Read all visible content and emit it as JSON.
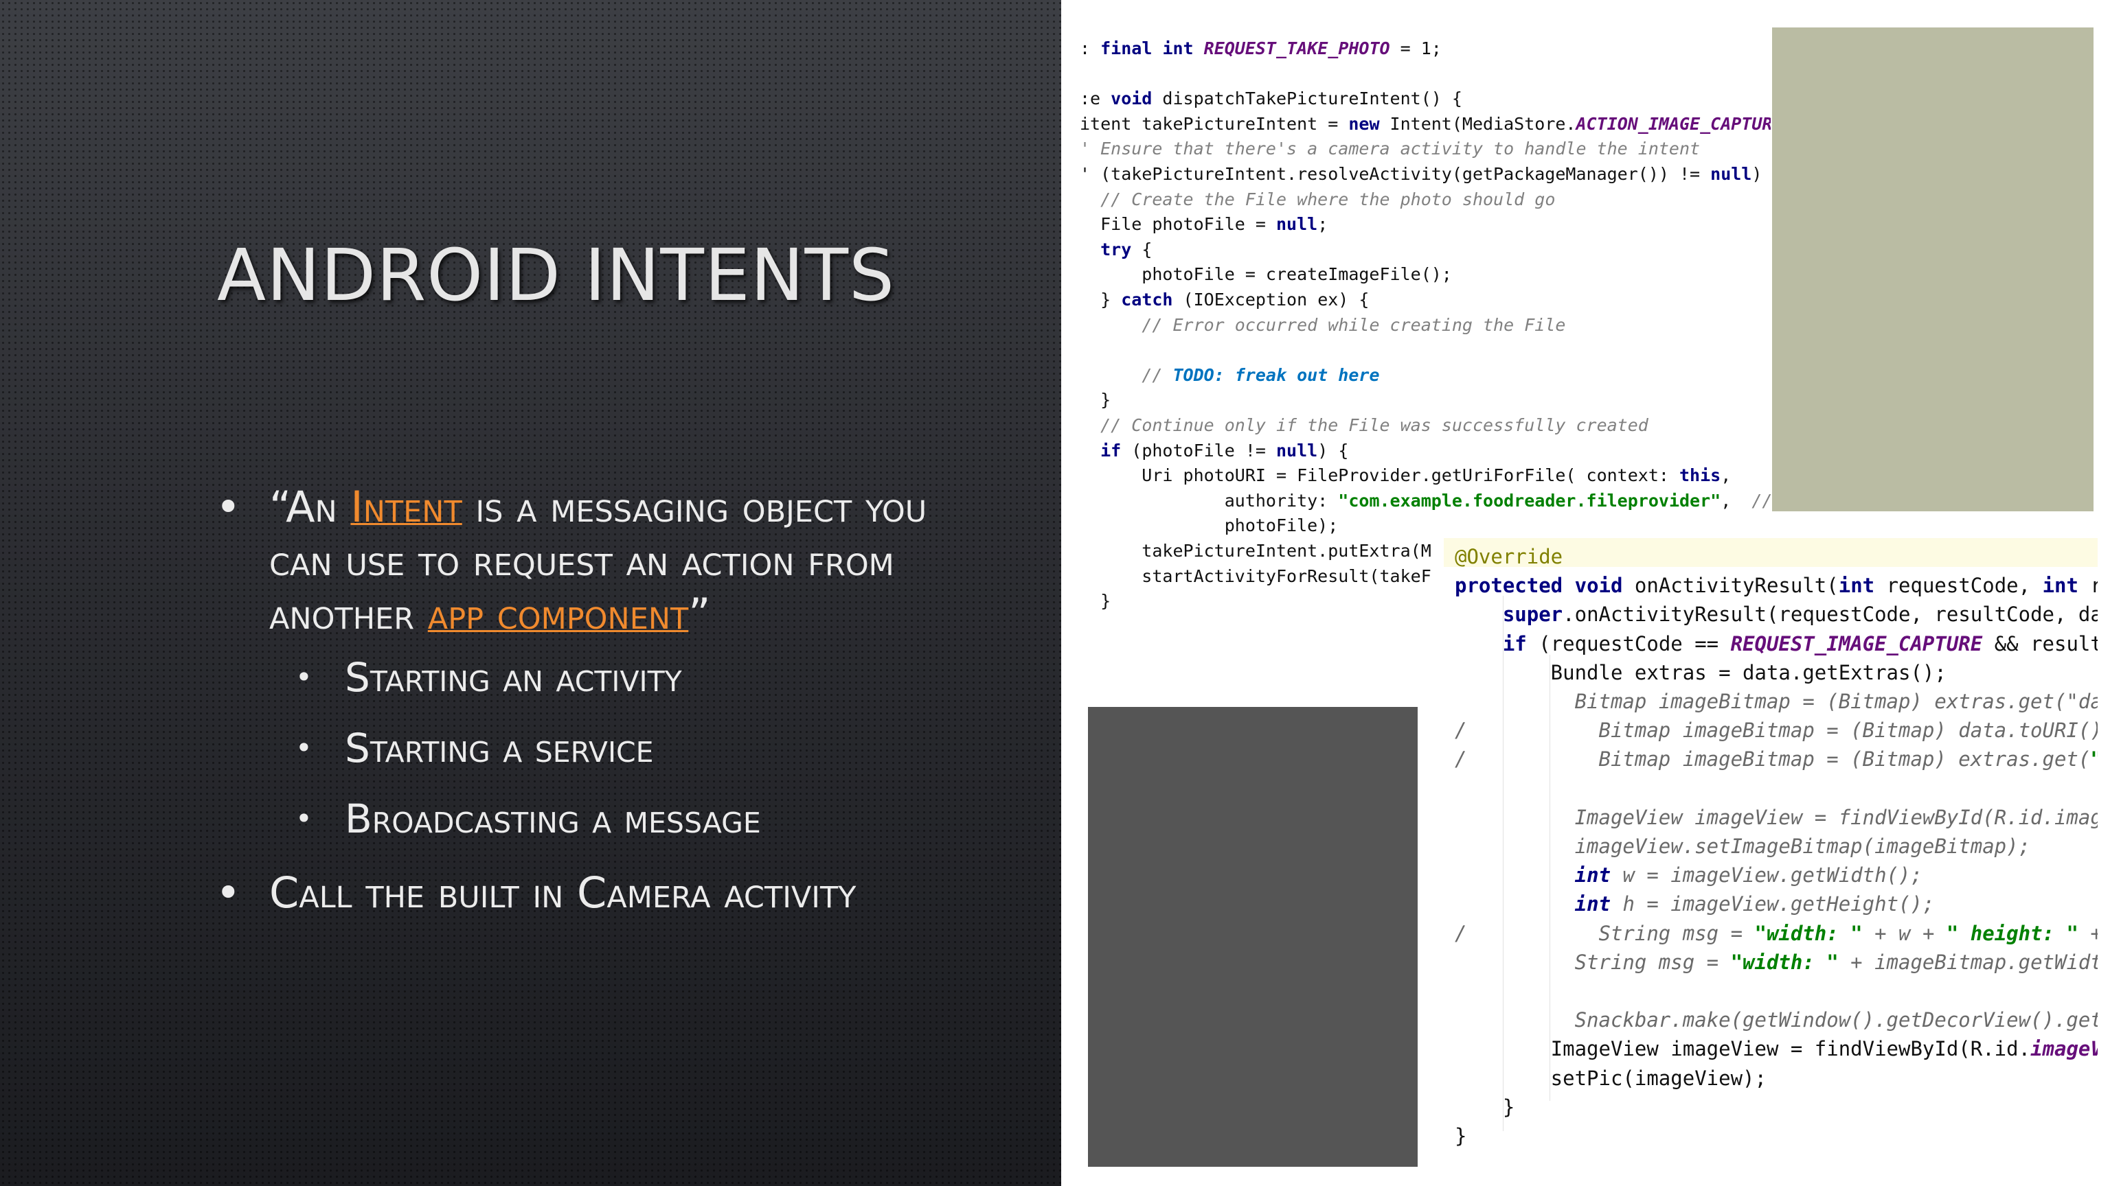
{
  "slide": {
    "title": "ANDROID INTENTS",
    "bullet_main": {
      "quote_open": "“An ",
      "link_intent": "Intent",
      "mid_text_1": " is a messaging object you",
      "line2": "can use to request an action from",
      "line3_prefix": "another ",
      "link_component": "app component",
      "quote_close": "”"
    },
    "subbullets": [
      "Starting an activity",
      "Starting a service",
      "Broadcasting a message"
    ],
    "bullet_second": "Call the built in Camera activity",
    "bullet_glyph": "•"
  },
  "code_top": {
    "lines": [
      ": final int REQUEST_TAKE_PHOTO = 1;",
      "",
      ":e void dispatchTakePictureIntent() {",
      "itent takePictureIntent = new Intent(MediaStore.ACTION_IMAGE_CAPTURE",
      "' Ensure that there's a camera activity to handle the intent",
      "' (takePictureIntent.resolveActivity(getPackageManager()) != null) {",
      "  // Create the File where the photo should go",
      "  File photoFile = null;",
      "  try {",
      "      photoFile = createImageFile();",
      "  } catch (IOException ex) {",
      "      // Error occurred while creating the File",
      "",
      "      // TODO: freak out here",
      "  }",
      "  // Continue only if the File was successfully created",
      "  if (photoFile != null) {",
      "      Uri photoURI = FileProvider.getUriForFile( context: this,",
      "              authority: \"com.example.foodreader.fileprovider\",  // N",
      "              photoFile);",
      "      takePictureIntent.putExtra(M",
      "      startActivityForResult(takeF",
      "  }"
    ]
  },
  "code_bottom": {
    "lines": [
      "@Override",
      "protected void onActivityResult(int requestCode, int res",
      "    super.onActivityResult(requestCode, resultCode, data",
      "    if (requestCode == REQUEST_IMAGE_CAPTURE && resultCo",
      "        Bundle extras = data.getExtras();",
      "          Bitmap imageBitmap = (Bitmap) extras.get(\"data",
      "/           Bitmap imageBitmap = (Bitmap) data.toURI();",
      "/           Bitmap imageBitmap = (Bitmap) extras.get(\"\")",
      "",
      "          ImageView imageView = findViewById(R.id.imageV",
      "          imageView.setImageBitmap(imageBitmap);",
      "          int w = imageView.getWidth();",
      "          int h = imageView.getHeight();",
      "/           String msg = \"width: \" + w + \" height: \" + h",
      "          String msg = \"width: \" + imageBitmap.getWidth(",
      "",
      "          Snackbar.make(getWindow().getDecorView().getRo",
      "        ImageView imageView = findViewById(R.id.imageVie",
      "        setPic(imageView);",
      "    }",
      "}"
    ]
  },
  "colors": {
    "accent_link": "#f08a2e",
    "keyword": "#000080",
    "constant": "#660e7a",
    "string": "#008000",
    "comment": "#808080",
    "todo": "#0073bf",
    "annotation": "#808000",
    "placeholder_khaki": "#babca3",
    "placeholder_gray": "#555555"
  }
}
